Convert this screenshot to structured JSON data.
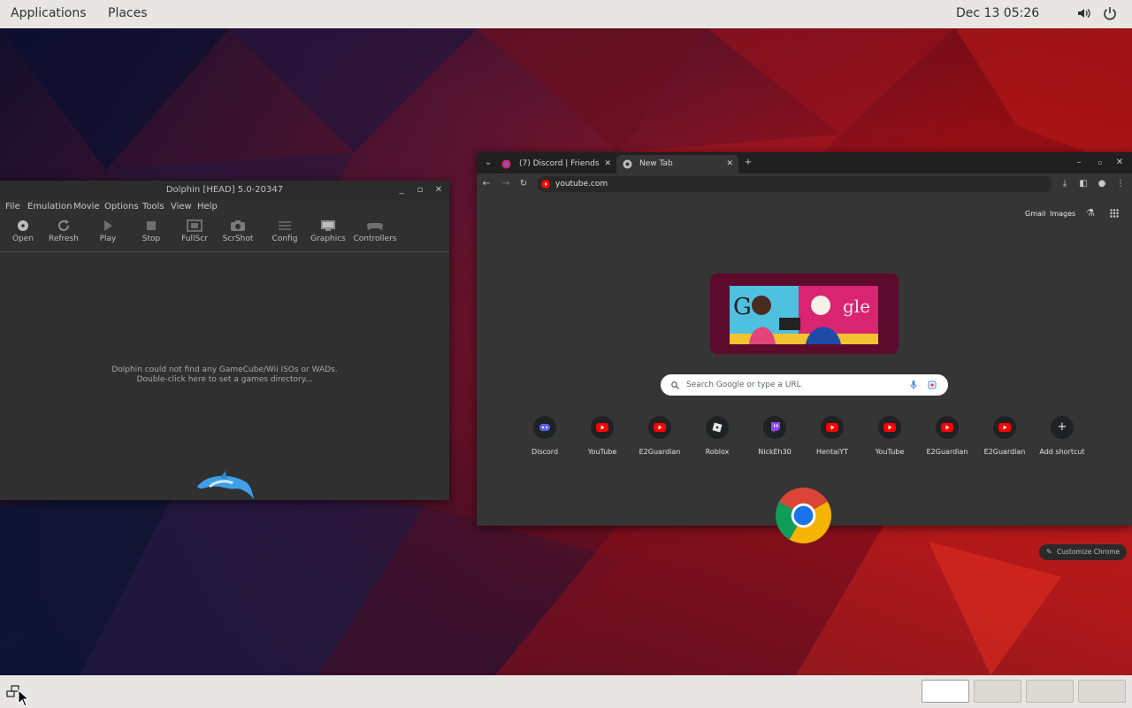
{
  "topbar": {
    "applications": "Applications",
    "places": "Places",
    "clock": "Dec 13  05:26",
    "icons": [
      "volume-icon",
      "power-icon"
    ]
  },
  "dolphin": {
    "title": "Dolphin [HEAD] 5.0-20347",
    "menu": [
      "File",
      "Emulation",
      "Movie",
      "Options",
      "Tools",
      "View",
      "Help"
    ],
    "toolbar": [
      "Open",
      "Refresh",
      "Play",
      "Stop",
      "FullScr",
      "ScrShot",
      "Config",
      "Graphics",
      "Controllers"
    ],
    "message_line1": "Dolphin could not find any GameCube/Wii ISOs or WADs.",
    "message_line2": "Double-click here to set a games directory..."
  },
  "chrome": {
    "tabs": [
      {
        "title": "(7) Discord | Friends"
      },
      {
        "title": "New Tab"
      }
    ],
    "omnibox_text": "youtube.com",
    "toplinks": {
      "gmail": "Gmail",
      "images": "Images"
    },
    "search_placeholder": "Search Google or type a URL",
    "shortcuts": [
      {
        "label": "Discord",
        "icon": "discord-icon"
      },
      {
        "label": "YouTube",
        "icon": "youtube-icon"
      },
      {
        "label": "E2Guardian",
        "icon": "youtube-icon"
      },
      {
        "label": "Roblox",
        "icon": "roblox-icon"
      },
      {
        "label": "NickEh30",
        "icon": "twitch-icon"
      },
      {
        "label": "HentaiYT",
        "icon": "youtube-icon"
      },
      {
        "label": "YouTube",
        "icon": "youtube-icon"
      },
      {
        "label": "E2Guardian",
        "icon": "youtube-icon"
      },
      {
        "label": "E2Guardian",
        "icon": "youtube-icon"
      },
      {
        "label": "Add shortcut",
        "icon": "plus-icon"
      }
    ],
    "customize_label": "Customize Chrome"
  },
  "colors": {
    "panel": "#e8e6e3",
    "youtube_red": "#ff0000",
    "discord_blurple": "#5865f2",
    "twitch_purple": "#9146ff"
  },
  "workspaces": {
    "count": 4,
    "active": 1
  }
}
